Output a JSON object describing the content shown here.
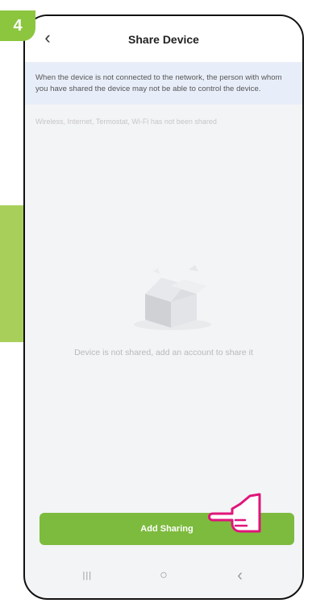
{
  "step": {
    "number": "4"
  },
  "header": {
    "back_glyph": "‹",
    "title": "Share Device"
  },
  "notice": {
    "text": "When the device is not connected to the network, the person with whom you have shared the device may not be able to control the device."
  },
  "shared_info": {
    "text": "Wireless, Internet, Termostat, Wi-Fi has not been shared"
  },
  "empty_state": {
    "text": "Device is not shared, add an account to share it",
    "icon": "empty-box-icon"
  },
  "add_button": {
    "label": "Add Sharing"
  },
  "navbar": {
    "recents_glyph": "|||",
    "home_glyph": "○",
    "back_glyph": "‹"
  },
  "colors": {
    "accent": "#7dbb3e",
    "step_badge": "#8cc63f",
    "notice_bg": "#e8eef9",
    "pointer": "#e0157a"
  }
}
